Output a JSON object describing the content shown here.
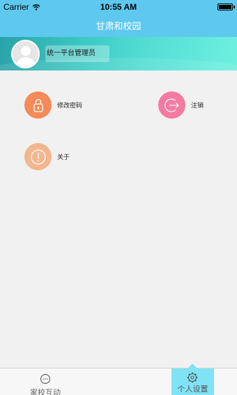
{
  "status_bar": {
    "carrier": "Carrier",
    "time": "10:55 AM"
  },
  "nav": {
    "title": "甘肃和校园"
  },
  "profile": {
    "name": "统一平台管理员"
  },
  "menu": {
    "change_password": {
      "label": "修改密码",
      "color": "#f48b58",
      "icon": "lock-icon"
    },
    "logout": {
      "label": "注销",
      "color": "#f47aa1",
      "icon": "logout-arrow-icon"
    },
    "about": {
      "label": "关于",
      "color": "#f2b78f",
      "icon": "info-icon"
    }
  },
  "tab_bar": {
    "tabs": [
      {
        "label": "家校互动",
        "icon": "chat-icon",
        "active": false
      },
      {
        "label": "个人设置",
        "icon": "gear-icon",
        "active": true
      }
    ]
  },
  "colors": {
    "header": "#5ec8ef",
    "active_tab": "#7fe3f5"
  }
}
